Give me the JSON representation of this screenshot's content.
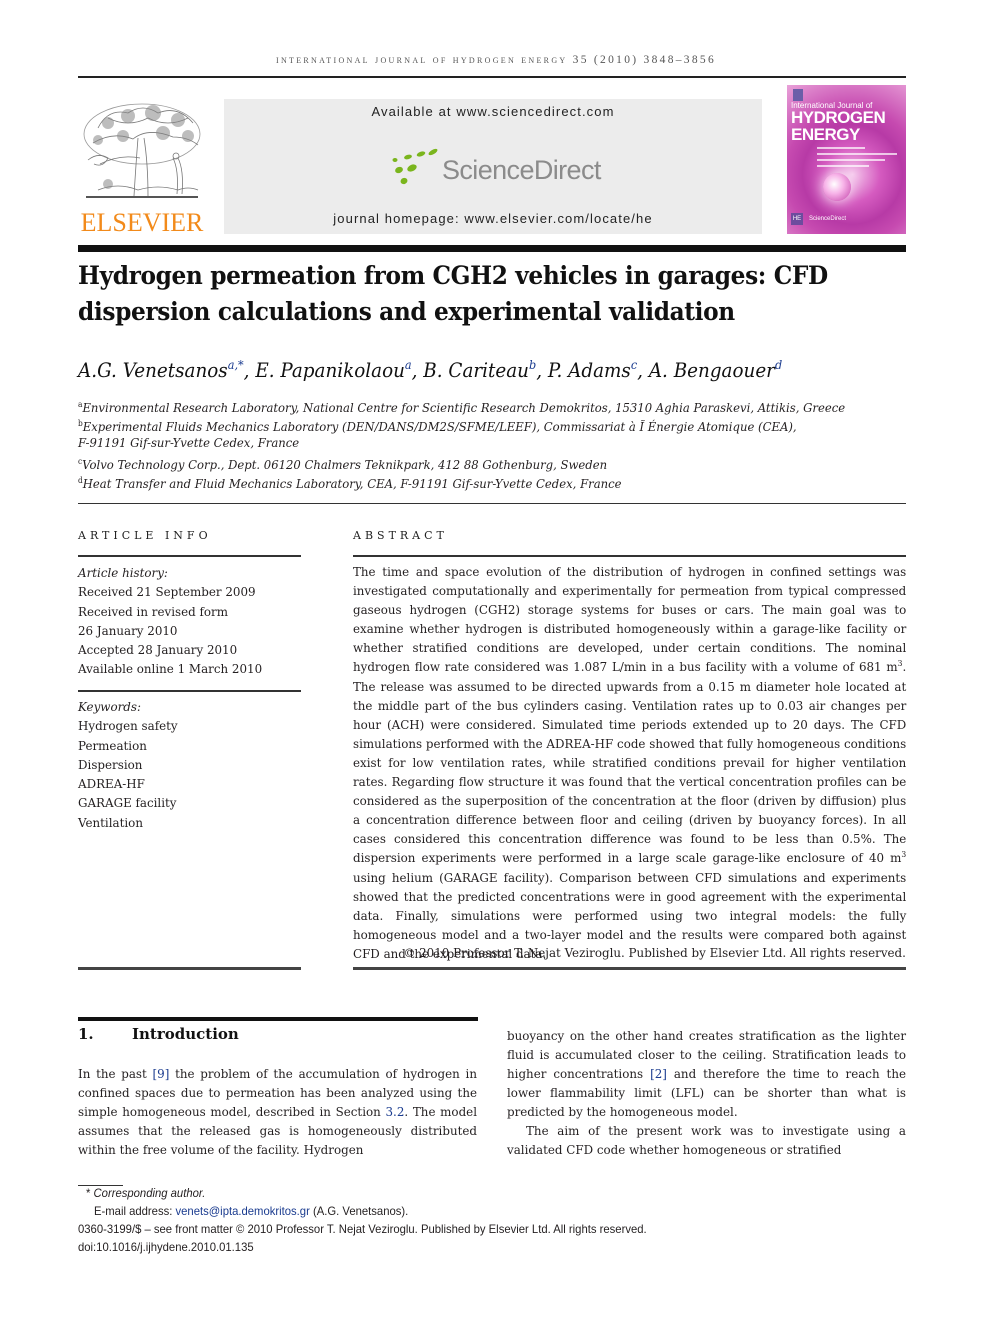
{
  "header": {
    "running_head": "international journal of hydrogen energy 35 (2010) 3848–3856",
    "publisher_logo_text": "ELSEVIER",
    "available_at": "Available at www.sciencedirect.com",
    "sciencedirect_logo_text": "ScienceDirect",
    "journal_homepage": "journal homepage: www.elsevier.com/locate/he",
    "cover": {
      "line1": "International Journal of",
      "line2": "HYDROGEN",
      "line3": "ENERGY",
      "badge": "HE",
      "sd_text": "ScienceDirect"
    }
  },
  "article": {
    "title": "Hydrogen permeation from CGH2 vehicles in garages: CFD dispersion calculations and experimental validation",
    "authors": [
      {
        "name": "A.G. Venetsanos",
        "sup": "a,*"
      },
      {
        "name": "E. Papanikolaou",
        "sup": "a"
      },
      {
        "name": "B. Cariteau",
        "sup": "b"
      },
      {
        "name": "P. Adams",
        "sup": "c"
      },
      {
        "name": "A. Bengaouer",
        "sup": "d"
      }
    ],
    "affiliations": [
      {
        "mark": "a",
        "text": "Environmental Research Laboratory, National Centre for Scientific Research Demokritos, 15310 Aghia Paraskevi, Attikis, Greece"
      },
      {
        "mark": "b",
        "text": "Experimental Fluids Mechanics Laboratory (DEN/DANS/DM2S/SFME/LEEF), Commissariat à Ĩ Énergie Atomique (CEA),"
      },
      {
        "mark": "",
        "text": "F-91191 Gif-sur-Yvette Cedex, France"
      },
      {
        "mark": "c",
        "text": "Volvo Technology Corp., Dept. 06120 Chalmers Teknikpark, 412 88 Gothenburg, Sweden"
      },
      {
        "mark": "d",
        "text": "Heat Transfer and Fluid Mechanics Laboratory, CEA, F-91191 Gif-sur-Yvette Cedex, France"
      }
    ]
  },
  "article_info": {
    "heading": "ARTICLE INFO",
    "history_label": "Article history:",
    "history": [
      "Received 21 September 2009",
      "Received in revised form",
      "26 January 2010",
      "Accepted 28 January 2010",
      "Available online 1 March 2010"
    ],
    "keywords_label": "Keywords:",
    "keywords": [
      "Hydrogen safety",
      "Permeation",
      "Dispersion",
      "ADREA-HF",
      "GARAGE facility",
      "Ventilation"
    ]
  },
  "abstract": {
    "heading": "ABSTRACT",
    "part1": "The time and space evolution of the distribution of hydrogen in confined settings was investigated computationally and experimentally for permeation from typical compressed gaseous hydrogen (CGH2) storage systems for buses or cars. The main goal was to examine whether hydrogen is distributed homogeneously within a garage-like facility or whether stratified conditions are developed, under certain conditions. The nominal hydrogen flow rate considered was 1.087 L/min in a bus facility with a volume of 681 m",
    "sup1": "3",
    "part2": ". The release was assumed to be directed upwards from a 0.15 m diameter hole located at the middle part of the bus cylinders casing. Ventilation rates up to 0.03 air changes per hour (ACH) were considered. Simulated time periods extended up to 20 days. The CFD simulations performed with the ADREA-HF code showed that fully homogeneous conditions exist for low ventilation rates, while stratified conditions prevail for higher ventilation rates. Regarding flow structure it was found that the vertical concentration profiles can be considered as the superposition of the concentration at the floor (driven by diffusion) plus a concentration difference between floor and ceiling (driven by buoyancy forces). In all cases considered this concentration difference was found to be less than 0.5%. The dispersion experiments were performed in a large scale garage-like enclosure of 40 m",
    "sup2": "3",
    "part3": " using helium (GARAGE facility). Comparison between CFD simulations and experiments showed that the predicted concentrations were in good agreement with the experimental data. Finally, simulations were performed using two integral models: the fully homogeneous model and a two-layer model and the results were compared both against CFD and the experimental data.",
    "copyright": "© 2010 Professor T. Nejat Veziroglu. Published by Elsevier Ltd. All rights reserved."
  },
  "introduction": {
    "number": "1.",
    "heading": "Introduction",
    "left_col": {
      "t1": "In the past ",
      "ref1": "[9]",
      "t2": " the problem of the accumulation of hydrogen in confined spaces due to permeation has been analyzed using the simple homogeneous model, described in Section ",
      "ref2": "3.2",
      "t3": ". The model assumes that the released gas is homogeneously distributed within the free volume of the facility. Hydrogen"
    },
    "right_col": {
      "t1": "buoyancy on the other hand creates stratification as the lighter fluid is accumulated closer to the ceiling. Stratification leads to higher concentrations ",
      "ref1": "[2]",
      "t2": " and therefore the time to reach the lower flammability limit (LFL) can be shorter than what is predicted by the homogeneous model.",
      "p2": "The aim of the present work was to investigate using a validated CFD code whether homogeneous or stratified"
    }
  },
  "footnotes": {
    "corresponding_mark": "*",
    "corresponding_label": "Corresponding author.",
    "email_label": "E-mail address: ",
    "email": "venets@ipta.demokritos.gr",
    "email_owner": " (A.G. Venetsanos).",
    "front_matter": "0360-3199/$ – see front matter © 2010 Professor T. Nejat Veziroglu. Published by Elsevier Ltd. All rights reserved.",
    "doi": "doi:10.1016/j.ijhydene.2010.01.135"
  },
  "colors": {
    "link": "#1a3b8f",
    "elsevier_orange": "#f28a1a",
    "sciencedirect_green": "#7ab51d",
    "banner_gray": "#ececec"
  }
}
